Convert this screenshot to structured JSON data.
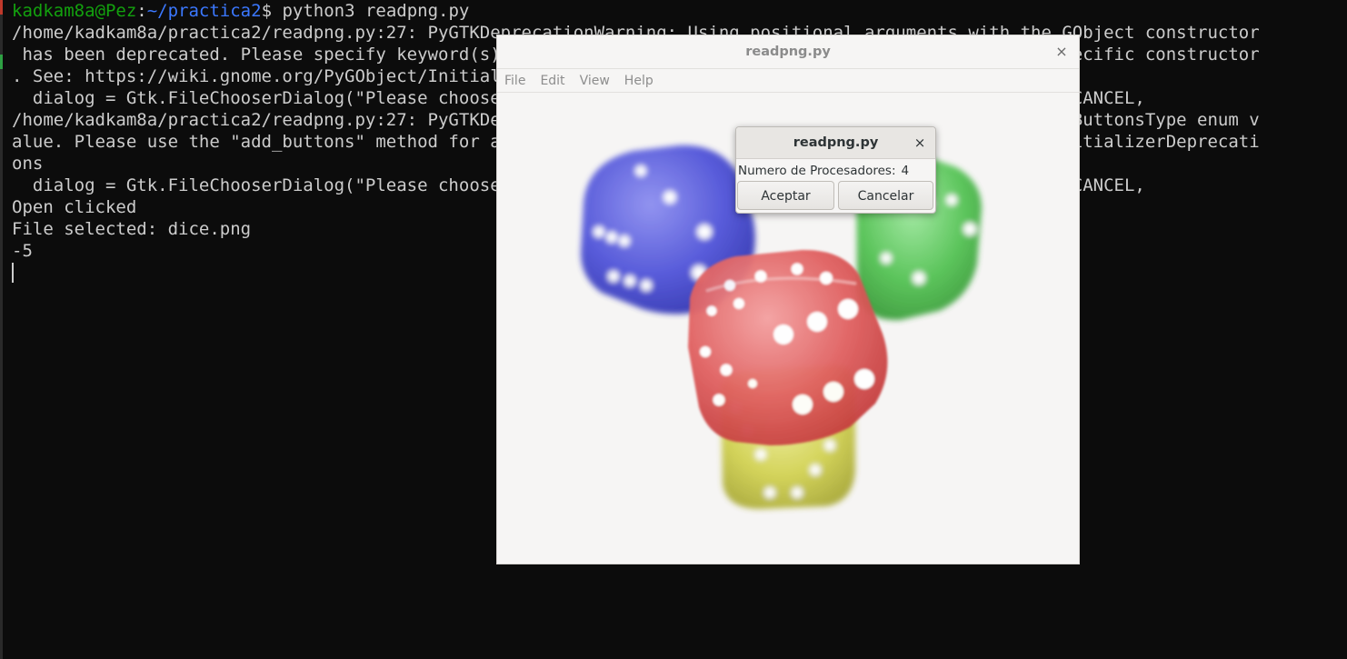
{
  "terminal": {
    "prompt_user_host": "kadkam8a@Pez",
    "prompt_sep": ":",
    "prompt_path": "~/practica2",
    "prompt_suffix": "$ python3 readpng.py",
    "lines": [
      "/home/kadkam8a/practica2/readpng.py:27: PyGTKDeprecationWarning: Using positional arguments with the GObject constructor",
      " has been deprecated. Please specify keyword(s) for \"title, parent, action, buttons\" or use a class specific constructor",
      ". See: https://wiki.gnome.org/PyGObject/InitializerDeprecations",
      "  dialog = Gtk.FileChooserDialog(\"Please choose a file\", self, Gtk.FileChooserAction.OPEN, (Gtk.STOCK_CANCEL,",
      "/home/kadkam8a/practica2/readpng.py:27: PyGTKDeprecationWarning: The \"buttons\" argument must be a Gtk.ButtonsType enum v",
      "alue. Please use the \"add_buttons\" method for adding buttons. See: https://wiki.gnome.org/PyGObject/InitializerDeprecati",
      "ons",
      "  dialog = Gtk.FileChooserDialog(\"Please choose a file\", self, Gtk.FileChooserAction.OPEN, (Gtk.STOCK_CANCEL,",
      "Open clicked",
      "File selected: dice.png",
      "-5"
    ]
  },
  "app_window": {
    "title": "readpng.py",
    "close_glyph": "×",
    "menu": [
      "File",
      "Edit",
      "View",
      "Help"
    ],
    "image_name": "dice.png"
  },
  "dialog": {
    "title": "readpng.py",
    "close_glyph": "×",
    "label": "Numero de Procesadores:",
    "value": "4",
    "accept_label": "Aceptar",
    "cancel_label": "Cancelar"
  },
  "colors": {
    "terminal_bg": "#0c0c0c",
    "terminal_fg": "#cccccc",
    "prompt_green": "#13a10e",
    "prompt_blue": "#3b78ff",
    "window_bg": "#f6f5f4"
  }
}
